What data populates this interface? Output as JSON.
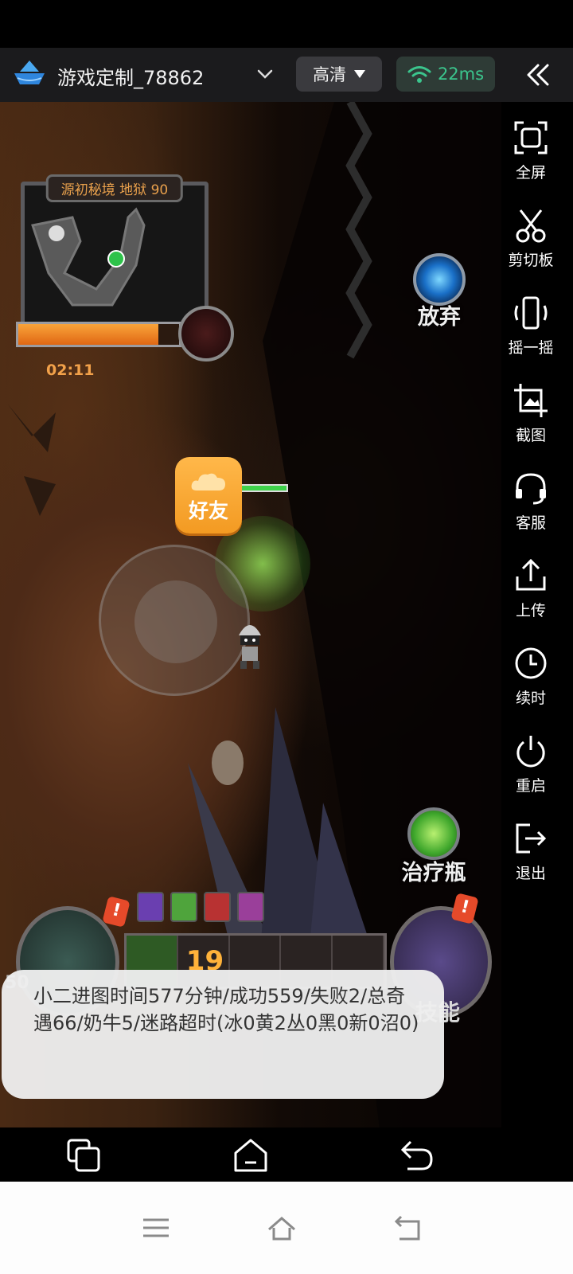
{
  "topbar": {
    "title": "游戏定制_78862",
    "quality_label": "高清",
    "ping_label": "22ms",
    "logo_icon": "cloud-boat-logo-icon",
    "expand_icon": "chevron-down-icon",
    "collapse_icon": "double-chevron-left-icon",
    "accent_ping": "#3bc58d"
  },
  "game": {
    "minimap_title": "源初秘境 地狱 90",
    "timer": "02:11",
    "timer_progress": 0.87,
    "abandon_label": "放弃",
    "friend_label": "好友",
    "potion_label": "治疗瓶",
    "skill_label": "技能",
    "item_count": "19",
    "hero_level": "50",
    "alert_mark": "!"
  },
  "toast": {
    "message": "小二进图时间577分钟/成功559/失败2/总奇遇66/奶牛5/迷路超时(冰0黄2丛0黑0新0沼0)"
  },
  "sidebar": {
    "items": [
      {
        "label": "全屏",
        "icon": "fullscreen-icon"
      },
      {
        "label": "剪切板",
        "icon": "scissors-icon"
      },
      {
        "label": "摇一摇",
        "icon": "shake-phone-icon"
      },
      {
        "label": "截图",
        "icon": "screenshot-icon"
      },
      {
        "label": "客服",
        "icon": "headset-icon"
      },
      {
        "label": "上传",
        "icon": "upload-icon"
      },
      {
        "label": "续时",
        "icon": "clock-icon"
      },
      {
        "label": "重启",
        "icon": "power-icon"
      },
      {
        "label": "退出",
        "icon": "exit-icon"
      }
    ]
  },
  "nav": {
    "remote": [
      "recent-apps-icon",
      "home-icon",
      "back-icon"
    ],
    "system": [
      "menu-icon",
      "home-icon",
      "back-icon"
    ]
  }
}
